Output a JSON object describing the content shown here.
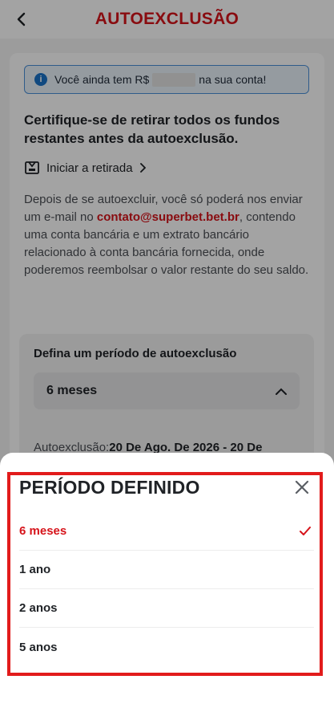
{
  "header": {
    "title": "AUTOEXCLUSÃO"
  },
  "info": {
    "prefix": "Você ainda tem R$",
    "suffix": "na sua conta!"
  },
  "warning": "Certifique-se de retirar todos os fundos restantes antes da autoexclusão.",
  "withdraw_link": "Iniciar a retirada",
  "body": {
    "part1": "Depois de se autoexcluir, você só poderá nos enviar um e-mail no ",
    "email": "contato@superbet.bet.br",
    "part2": ", contendo uma conta bancária e um extrato bancário relacionado à conta bancária fornecida, onde poderemos reembolsar o valor restante do seu saldo."
  },
  "period": {
    "label": "Defina um período de autoexclusão",
    "selected": "6 meses",
    "dates_prefix": "Autoexclusão:",
    "dates_value": "20 De Ago. De 2026 - 20 De"
  },
  "sheet": {
    "title": "PERÍODO DEFINIDO",
    "options": [
      {
        "label": "6 meses",
        "selected": true
      },
      {
        "label": "1 ano",
        "selected": false
      },
      {
        "label": "2 anos",
        "selected": false
      },
      {
        "label": "5 anos",
        "selected": false
      }
    ]
  },
  "colors": {
    "brand_red": "#d6131a",
    "info_blue": "#1a73c9",
    "highlight_red": "#e21b1b"
  },
  "icons": [
    "back-arrow-icon",
    "info-icon",
    "wallet-icon",
    "chevron-right-icon",
    "chevron-up-icon",
    "close-icon",
    "check-icon"
  ]
}
